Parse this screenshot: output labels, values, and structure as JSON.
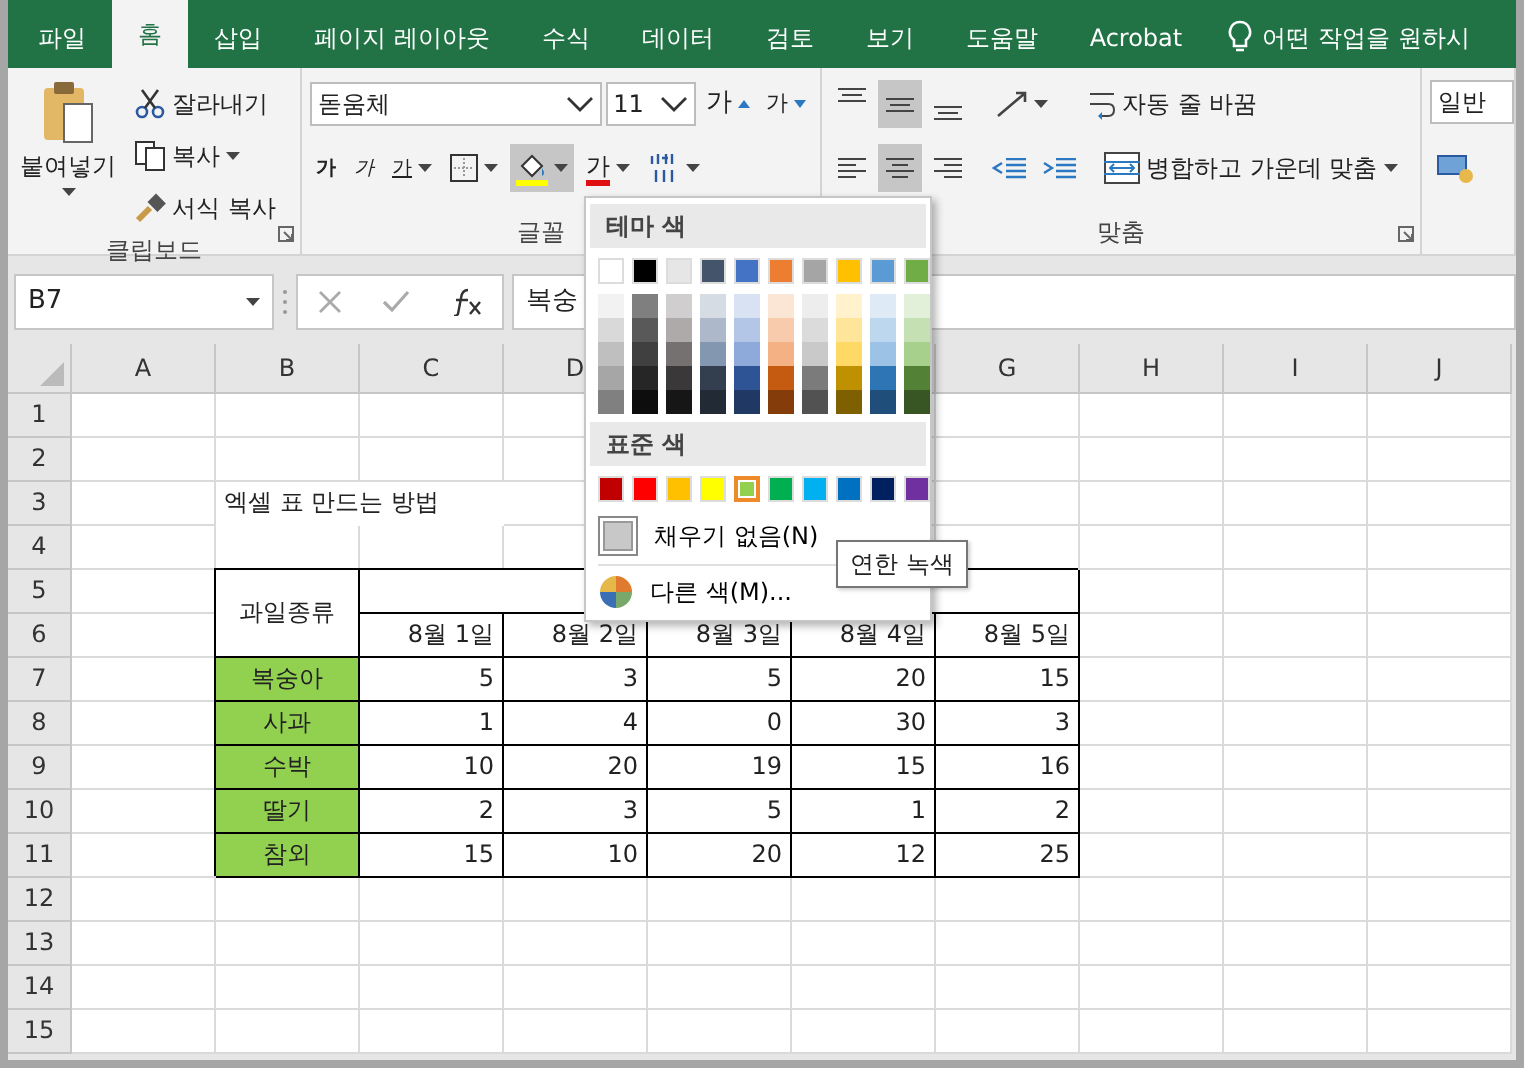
{
  "tabs": [
    {
      "label": "파일",
      "selected": false
    },
    {
      "label": "홈",
      "selected": true
    },
    {
      "label": "삽입",
      "selected": false
    },
    {
      "label": "페이지 레이아웃",
      "selected": false
    },
    {
      "label": "수식",
      "selected": false
    },
    {
      "label": "데이터",
      "selected": false
    },
    {
      "label": "검토",
      "selected": false
    },
    {
      "label": "보기",
      "selected": false
    },
    {
      "label": "도움말",
      "selected": false
    },
    {
      "label": "Acrobat",
      "selected": false
    }
  ],
  "tell_me": "어떤 작업을 원하시",
  "clipboard": {
    "paste": "붙여넣기",
    "cut": "잘라내기",
    "copy": "복사",
    "format_painter": "서식 복사",
    "label": "클립보드"
  },
  "font": {
    "name": "돋움체",
    "size": "11",
    "grow": "가",
    "shrink": "가",
    "bold": "가",
    "italic": "가",
    "underline": "가",
    "font_color": "가",
    "label": "글꼴"
  },
  "alignment": {
    "vertical": [
      {
        "kind": "top",
        "selected": false
      },
      {
        "kind": "middle",
        "selected": true
      },
      {
        "kind": "bottom",
        "selected": false
      }
    ],
    "horizontal": [
      {
        "kind": "left",
        "selected": false
      },
      {
        "kind": "center",
        "selected": true
      },
      {
        "kind": "right",
        "selected": false
      }
    ],
    "wrap_text": "자동 줄 바꿈",
    "merge_center": "병합하고 가운데 맞춤",
    "label": "맞춤"
  },
  "number": {
    "format": "일반"
  },
  "formula_bar": {
    "name_box": "B7",
    "content": "복숭"
  },
  "sheet": {
    "columns": [
      "A",
      "B",
      "C",
      "D",
      null,
      null,
      "G",
      "H",
      "I",
      "J"
    ],
    "row_numbers": [
      "1",
      "2",
      "3",
      "4",
      "5",
      "6",
      "7",
      "8",
      "9",
      "10",
      "11",
      "12",
      "13",
      "14",
      "15"
    ],
    "title": "엑셀 표 만드는 방법",
    "table": {
      "header": "과일종류",
      "dates": [
        "8월  1일",
        "8월  2일",
        "8월  3일",
        "8월  4일",
        "8월  5일"
      ],
      "rows": [
        {
          "name": "복숭아",
          "color": "#92d050",
          "values": [
            "5",
            "3",
            "5",
            "20",
            "15"
          ]
        },
        {
          "name": "사과",
          "color": "#92d050",
          "values": [
            "1",
            "4",
            "0",
            "30",
            "3"
          ]
        },
        {
          "name": "수박",
          "color": "#92d050",
          "values": [
            "10",
            "20",
            "19",
            "15",
            "16"
          ]
        },
        {
          "name": "딸기",
          "color": "#92d050",
          "values": [
            "2",
            "3",
            "5",
            "1",
            "2"
          ]
        },
        {
          "name": "참외",
          "color": "#92d050",
          "values": [
            "15",
            "10",
            "20",
            "12",
            "25"
          ]
        }
      ]
    }
  },
  "color_picker": {
    "theme_title": "테마 색",
    "theme_top": [
      {
        "color": "#ffffff",
        "selected": false
      },
      {
        "color": "#000000",
        "selected": false
      },
      {
        "color": "#e7e6e6",
        "selected": false
      },
      {
        "color": "#44546a",
        "selected": false
      },
      {
        "color": "#4472c4",
        "selected": false
      },
      {
        "color": "#ed7d31",
        "selected": false
      },
      {
        "color": "#a5a5a5",
        "selected": false
      },
      {
        "color": "#ffc000",
        "selected": false
      },
      {
        "color": "#5b9bd5",
        "selected": false
      },
      {
        "color": "#70ad47",
        "selected": false
      }
    ],
    "theme_shades": [
      [
        {
          "color": "#f2f2f2",
          "selected": false
        },
        {
          "color": "#7f7f7f",
          "selected": false
        },
        {
          "color": "#d0cece",
          "selected": false
        },
        {
          "color": "#d6dce4",
          "selected": false
        },
        {
          "color": "#d9e2f3",
          "selected": false
        },
        {
          "color": "#fbe5d5",
          "selected": false
        },
        {
          "color": "#ededed",
          "selected": false
        },
        {
          "color": "#fff2cc",
          "selected": false
        },
        {
          "color": "#deebf6",
          "selected": false
        },
        {
          "color": "#e2efd9",
          "selected": false
        }
      ],
      [
        {
          "color": "#d9d9d9",
          "selected": false
        },
        {
          "color": "#595959",
          "selected": false
        },
        {
          "color": "#aeaaaa",
          "selected": false
        },
        {
          "color": "#adb9ca",
          "selected": false
        },
        {
          "color": "#b4c6e7",
          "selected": false
        },
        {
          "color": "#f7cbac",
          "selected": false
        },
        {
          "color": "#dbdbdb",
          "selected": false
        },
        {
          "color": "#fee599",
          "selected": false
        },
        {
          "color": "#bdd7ee",
          "selected": false
        },
        {
          "color": "#c5e0b3",
          "selected": false
        }
      ],
      [
        {
          "color": "#bfbfbf",
          "selected": false
        },
        {
          "color": "#404040",
          "selected": false
        },
        {
          "color": "#757171",
          "selected": false
        },
        {
          "color": "#8497b0",
          "selected": false
        },
        {
          "color": "#8eaadb",
          "selected": false
        },
        {
          "color": "#f4b183",
          "selected": false
        },
        {
          "color": "#c9c9c9",
          "selected": false
        },
        {
          "color": "#ffd965",
          "selected": false
        },
        {
          "color": "#9cc3e5",
          "selected": false
        },
        {
          "color": "#a8d08d",
          "selected": false
        }
      ],
      [
        {
          "color": "#a6a6a6",
          "selected": false
        },
        {
          "color": "#262626",
          "selected": false
        },
        {
          "color": "#3a3838",
          "selected": false
        },
        {
          "color": "#333f4f",
          "selected": false
        },
        {
          "color": "#2f5496",
          "selected": false
        },
        {
          "color": "#c55a11",
          "selected": false
        },
        {
          "color": "#7b7b7b",
          "selected": false
        },
        {
          "color": "#bf9000",
          "selected": false
        },
        {
          "color": "#2e75b5",
          "selected": false
        },
        {
          "color": "#538135",
          "selected": false
        }
      ],
      [
        {
          "color": "#808080",
          "selected": false
        },
        {
          "color": "#0d0d0d",
          "selected": false
        },
        {
          "color": "#171616",
          "selected": false
        },
        {
          "color": "#222a35",
          "selected": false
        },
        {
          "color": "#1f3864",
          "selected": false
        },
        {
          "color": "#843c0b",
          "selected": false
        },
        {
          "color": "#525252",
          "selected": false
        },
        {
          "color": "#7f6000",
          "selected": false
        },
        {
          "color": "#1e4e79",
          "selected": false
        },
        {
          "color": "#375623",
          "selected": false
        }
      ]
    ],
    "standard_title": "표준 색",
    "standard": [
      {
        "color": "#c00000",
        "selected": false
      },
      {
        "color": "#ff0000",
        "selected": false
      },
      {
        "color": "#ffc000",
        "selected": false
      },
      {
        "color": "#ffff00",
        "selected": false
      },
      {
        "color": "#92d050",
        "selected": true
      },
      {
        "color": "#00b050",
        "selected": false
      },
      {
        "color": "#00b0f0",
        "selected": false
      },
      {
        "color": "#0070c0",
        "selected": false
      },
      {
        "color": "#002060",
        "selected": false
      },
      {
        "color": "#7030a0",
        "selected": false
      }
    ],
    "no_fill": "채우기 없음(N)",
    "more_colors": "다른 색(M)...",
    "tooltip": "연한 녹색"
  }
}
